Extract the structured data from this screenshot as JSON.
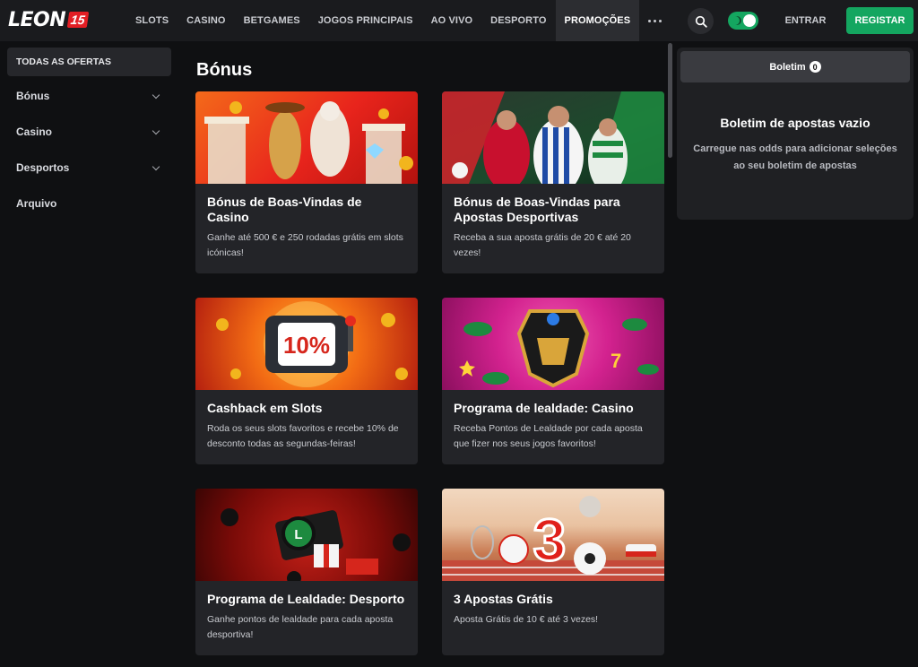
{
  "header": {
    "logo_text": "LEON",
    "logo_badge": "15",
    "nav": [
      "SLOTS",
      "CASINO",
      "BETGAMES",
      "JOGOS PRINCIPAIS",
      "AO VIVO",
      "DESPORTO",
      "PROMOÇÕES"
    ],
    "active_nav": "PROMOÇÕES",
    "login_label": "ENTRAR",
    "register_label": "REGISTAR",
    "accent_color": "#14a660"
  },
  "sidebar": {
    "all_offers": "TODAS AS OFERTAS",
    "items": [
      {
        "label": "Bónus",
        "expandable": true
      },
      {
        "label": "Casino",
        "expandable": true
      },
      {
        "label": "Desportos",
        "expandable": true
      },
      {
        "label": "Arquivo",
        "expandable": false
      }
    ]
  },
  "main": {
    "title": "Bónus",
    "cards": [
      {
        "title": "Bónus de Boas-Vindas de Casino",
        "desc": "Ganhe até 500 € e 250 rodadas grátis em slots icónicas!"
      },
      {
        "title": "Bónus de Boas-Vindas para Apostas Desportivas",
        "desc": "Receba a sua aposta grátis de 20 € até 20 vezes!"
      },
      {
        "title": "Cashback em Slots",
        "desc": "Roda os seus slots favoritos e recebe 10% de desconto todas as segundas-feiras!"
      },
      {
        "title": "Programa de lealdade: Casino",
        "desc": "Receba Pontos de Lealdade por cada aposta que fizer nos seus jogos favoritos!"
      },
      {
        "title": "Programa de Lealdade: Desporto",
        "desc": "Ganhe pontos de lealdade para cada aposta desportiva!"
      },
      {
        "title": "3 Apostas Grátis",
        "desc": "Aposta Grátis de 10 € até 3 vezes!"
      }
    ]
  },
  "betslip": {
    "tab_label": "Boletim",
    "count": "0",
    "empty_title": "Boletim de apostas vazio",
    "empty_desc": "Carregue nas odds para adicionar seleções ao seu boletim de apostas"
  }
}
